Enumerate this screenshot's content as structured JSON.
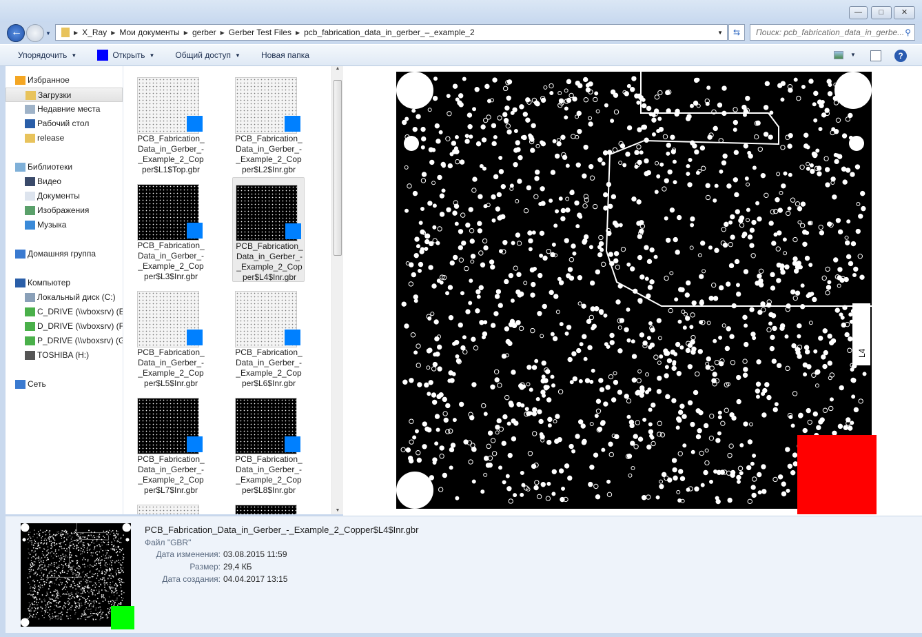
{
  "window": {
    "minimize": "—",
    "maximize": "□",
    "close": "✕"
  },
  "breadcrumb": [
    "X_Ray",
    "Мои документы",
    "gerber",
    "Gerber Test Files",
    "pcb_fabrication_data_in_gerber_–_example_2"
  ],
  "search": {
    "placeholder": "Поиск: pcb_fabrication_data_in_gerbe..."
  },
  "toolbar": {
    "organize": "Упорядочить",
    "open": "Открыть",
    "share": "Общий доступ",
    "new_folder": "Новая папка"
  },
  "sidebar": {
    "favorites": {
      "label": "Избранное",
      "items": [
        "Загрузки",
        "Недавние места",
        "Рабочий стол",
        "release"
      ]
    },
    "libraries": {
      "label": "Библиотеки",
      "items": [
        "Видео",
        "Документы",
        "Изображения",
        "Музыка"
      ]
    },
    "homegroup": "Домашняя группа",
    "computer": {
      "label": "Компьютер",
      "items": [
        "Локальный диск (C:)",
        "C_DRIVE (\\\\vboxsrv) (E",
        "D_DRIVE (\\\\vboxsrv) (F",
        "P_DRIVE (\\\\vboxsrv) (G",
        "TOSHIBA (H:)"
      ]
    },
    "network": "Сеть"
  },
  "files": [
    {
      "name": "PCB_Fabrication_ Data_in_Gerber_- _Example_2_Cop per$L1$Top.gbr",
      "lines": [
        "PCB_Fabrication_",
        "Data_in_Gerber_-",
        "_Example_2_Cop",
        "per$L1$Top.gbr"
      ],
      "dark": false
    },
    {
      "lines": [
        "PCB_Fabrication_",
        "Data_in_Gerber_-",
        "_Example_2_Cop",
        "per$L2$Inr.gbr"
      ],
      "dark": false
    },
    {
      "lines": [
        "PCB_Fabrication_",
        "Data_in_Gerber_-",
        "_Example_2_Cop",
        "per$L3$Inr.gbr"
      ],
      "dark": true
    },
    {
      "lines": [
        "PCB_Fabrication_",
        "Data_in_Gerber_-",
        "_Example_2_Cop",
        "per$L4$Inr.gbr"
      ],
      "dark": true,
      "selected": true
    },
    {
      "lines": [
        "PCB_Fabrication_",
        "Data_in_Gerber_-",
        "_Example_2_Cop",
        "per$L5$Inr.gbr"
      ],
      "dark": false
    },
    {
      "lines": [
        "PCB_Fabrication_",
        "Data_in_Gerber_-",
        "_Example_2_Cop",
        "per$L6$Inr.gbr"
      ],
      "dark": false
    },
    {
      "lines": [
        "PCB_Fabrication_",
        "Data_in_Gerber_-",
        "_Example_2_Cop",
        "per$L7$Inr.gbr"
      ],
      "dark": true
    },
    {
      "lines": [
        "PCB_Fabrication_",
        "Data_in_Gerber_-",
        "_Example_2_Cop",
        "per$L8$Inr.gbr"
      ],
      "dark": true
    }
  ],
  "preview": {
    "layer_label": "L4"
  },
  "details": {
    "filename": "PCB_Fabrication_Data_in_Gerber_-_Example_2_Copper$L4$Inr.gbr",
    "type": "Файл \"GBR\"",
    "modified_label": "Дата изменения:",
    "modified": "03.08.2015 11:59",
    "size_label": "Размер:",
    "size": "29,4 КБ",
    "created_label": "Дата создания:",
    "created": "04.04.2017 13:15"
  },
  "colors": {
    "badge": "#0080ff",
    "open_icon": "#0000ff",
    "red_marker": "#ff0000",
    "green_marker": "#00ff00"
  }
}
